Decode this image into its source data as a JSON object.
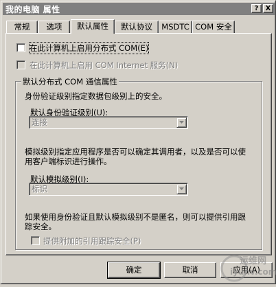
{
  "window": {
    "title": "我的电脑 属性",
    "help_glyph": "?",
    "close_glyph": "X"
  },
  "tabs": [
    {
      "label": "常规"
    },
    {
      "label": "选项"
    },
    {
      "label": "默认属性"
    },
    {
      "label": "默认协议"
    },
    {
      "label": "MSDTC"
    },
    {
      "label": "COM 安全"
    }
  ],
  "options": {
    "enable_dcom": {
      "label": "在此计算机上启用分布式 COM(E)",
      "checked": false
    },
    "enable_com_internet": {
      "label": "在此计算机上启用 COM Internet 服务(N)",
      "checked": false
    }
  },
  "group": {
    "legend": "默认分布式 COM 通信属性",
    "auth_desc": "身份验证级别指定数据包级别上的安全。",
    "auth_label": "默认身份验证级别(U):",
    "auth_value": "连接",
    "imp_desc_line1": "模拟级别指定应用程序是否可以确定其调用者，以及是否可以使",
    "imp_desc_line2": "用客户端标识进行操作。",
    "imp_label": "默认模拟级别(I):",
    "imp_value": "标识",
    "ref_desc_line1": "如果使用身份验证且默认模拟级别不是匿名，则可以提供引用跟",
    "ref_desc_line2": "踪安全。",
    "ref_checkbox": "提供附加的引用跟踪安全(P)"
  },
  "buttons": {
    "ok": "确定",
    "cancel": "取消",
    "apply": "应用(A)"
  },
  "watermark": {
    "text_cn": "运维网",
    "text_en": "iyunv.com"
  }
}
